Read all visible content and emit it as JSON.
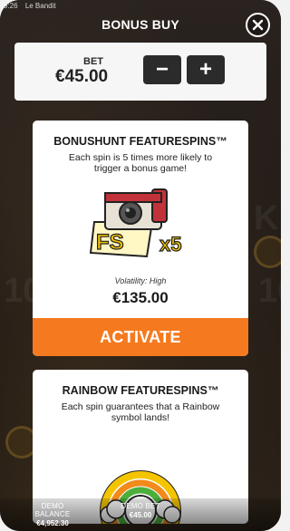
{
  "status_bar": {
    "time": "9:26",
    "app_name": "Le Bandit"
  },
  "modal": {
    "title": "BONUS BUY",
    "close_icon": "close-icon"
  },
  "bet": {
    "label": "BET",
    "value": "€45.00",
    "minus_label": "−",
    "plus_label": "+"
  },
  "cards": [
    {
      "title": "BONUSHUNT FEATURESPINS™",
      "description": "Each spin is 5 times more likely to trigger a bonus game!",
      "art_text": "FS",
      "art_multiplier": "x5",
      "volatility": "Volatility: High",
      "price": "€135.00",
      "action_label": "ACTIVATE"
    },
    {
      "title": "RAINBOW FEATURESPINS™",
      "description": "Each spin guarantees that a Rainbow symbol lands!"
    }
  ],
  "footer": {
    "balance_label": "DEMO BALANCE",
    "balance_value": "€4,952.30",
    "bet_label": "DEMO BET",
    "bet_value": "€45.00"
  },
  "colors": {
    "accent_orange": "#f57a1f",
    "panel": "#f6f6f6",
    "dark_button": "#2b2b2b"
  }
}
